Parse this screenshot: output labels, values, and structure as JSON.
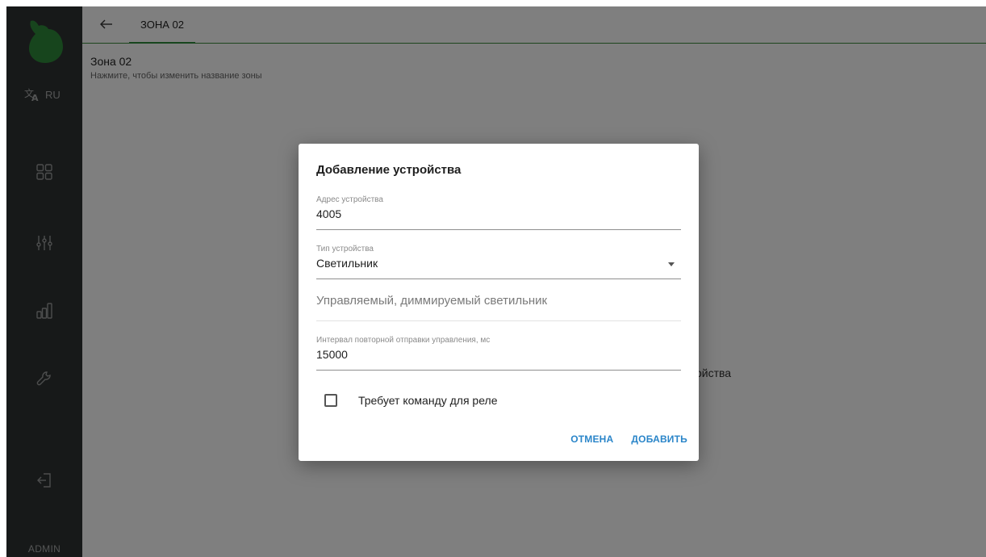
{
  "sidebar": {
    "language": "RU",
    "user": "ADMIN",
    "nav_icons": [
      "dashboard-icon",
      "sliders-icon",
      "chart-icon",
      "wrench-icon",
      "logout-icon"
    ]
  },
  "header": {
    "tab_label": "ЗОНА 02"
  },
  "zone": {
    "title": "Зона 02",
    "hint": "Нажмите, чтобы изменить название зоны",
    "background_partial": "ойства"
  },
  "dialog": {
    "title": "Добавление устройства",
    "address_label": "Адрес устройства",
    "address_value": "4005",
    "type_label": "Тип устройства",
    "type_value": "Светильник",
    "description": "Управляемый, диммируемый светильник",
    "interval_label": "Интервал повторной отправки управления, мс",
    "interval_value": "15000",
    "relay_checkbox_label": "Требует команду для реле",
    "relay_checked": false,
    "cancel_label": "ОТМЕНА",
    "add_label": "ДОБАВИТЬ"
  },
  "colors": {
    "sidebar_bg": "#2f3233",
    "accent_green": "#2e8b3a",
    "button_blue": "#2a85c9"
  }
}
